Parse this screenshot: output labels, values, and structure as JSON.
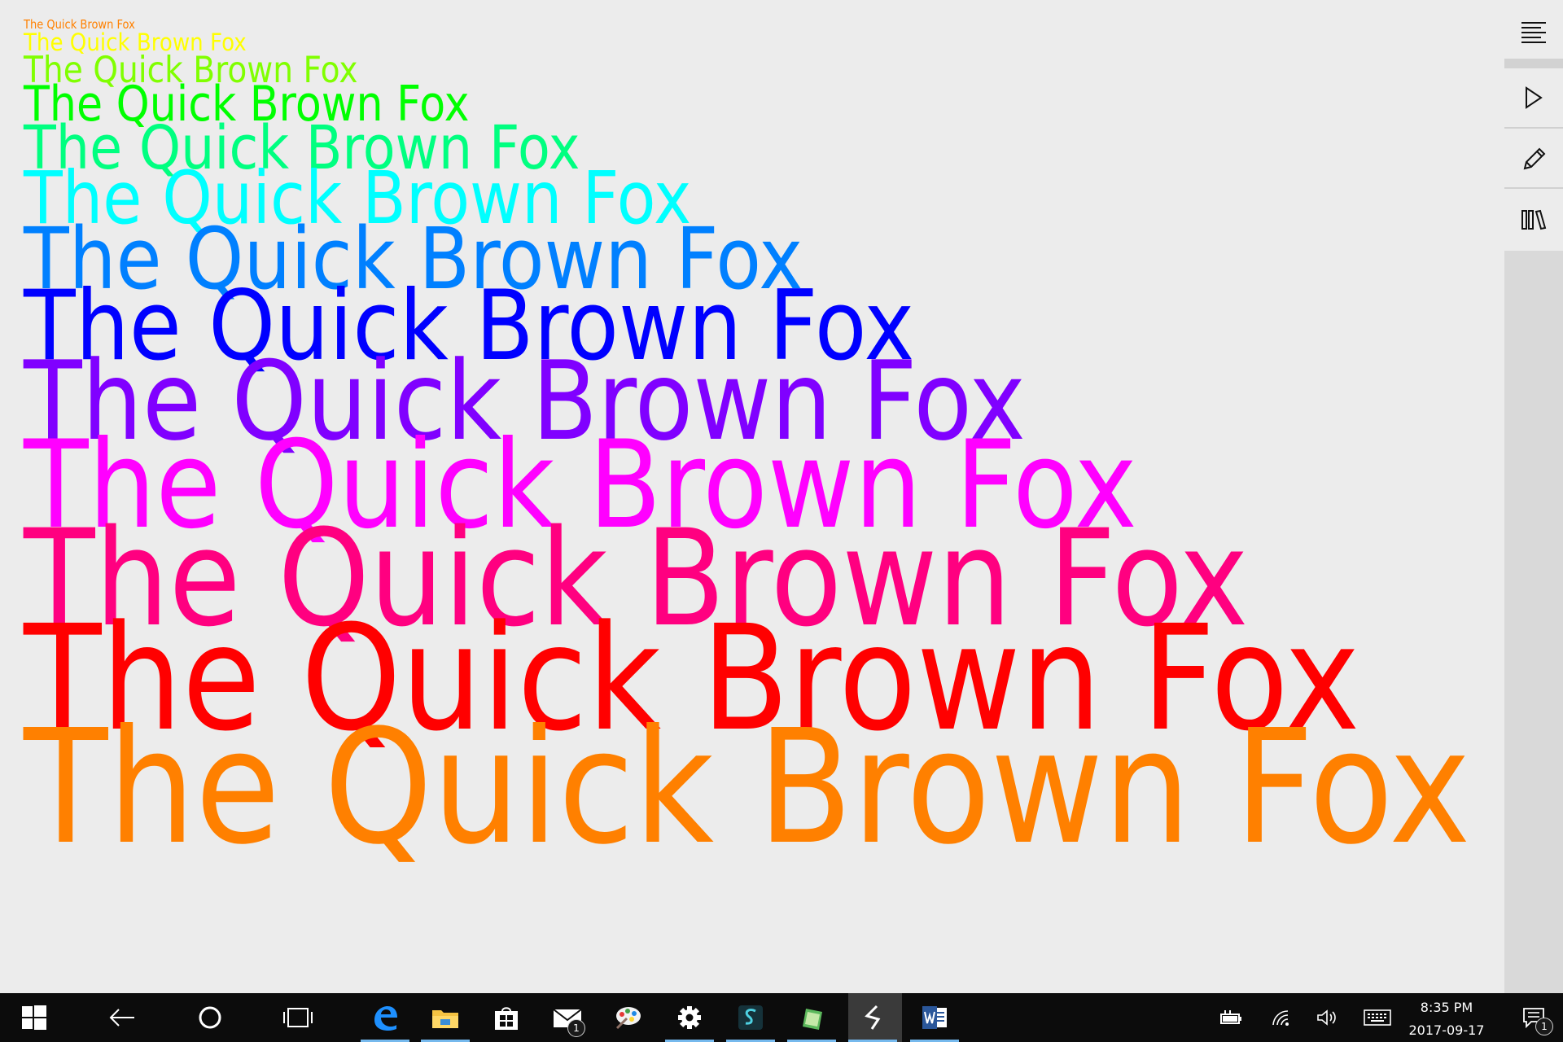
{
  "canvas": {
    "lines": [
      {
        "text": "The Quick Brown Fox",
        "color": "#ff8000",
        "size": 12
      },
      {
        "text": "The Quick Brown Fox",
        "color": "#ffff00",
        "size": 24
      },
      {
        "text": "The Quick Brown Fox",
        "color": "#80ff00",
        "size": 36
      },
      {
        "text": "The Quick Brown Fox",
        "color": "#00ff00",
        "size": 48
      },
      {
        "text": "The Quick Brown Fox",
        "color": "#00ff80",
        "size": 60
      },
      {
        "text": "The Quick Brown Fox",
        "color": "#00ffff",
        "size": 72
      },
      {
        "text": "The Quick Brown Fox",
        "color": "#0080ff",
        "size": 84
      },
      {
        "text": "The Quick Brown Fox",
        "color": "#0000ff",
        "size": 96
      },
      {
        "text": "The Quick Brown Fox",
        "color": "#8000ff",
        "size": 108
      },
      {
        "text": "The Quick Brown Fox",
        "color": "#ff00ff",
        "size": 120
      },
      {
        "text": "The Quick Brown Fox",
        "color": "#ff0080",
        "size": 132
      },
      {
        "text": "The Quick Brown Fox",
        "color": "#ff0000",
        "size": 144
      },
      {
        "text": "The Quick Brown Fox",
        "color": "#ff8000",
        "size": 156
      }
    ]
  },
  "sidebar": {
    "buttons": [
      {
        "name": "menu-lines-icon"
      },
      {
        "name": "play-icon"
      },
      {
        "name": "pencil-icon"
      },
      {
        "name": "library-icon"
      }
    ]
  },
  "taskbar": {
    "apps": [
      {
        "name": "edge-icon"
      },
      {
        "name": "file-explorer-icon"
      },
      {
        "name": "store-icon"
      },
      {
        "name": "mail-icon"
      },
      {
        "name": "paint-icon"
      },
      {
        "name": "settings-gear-icon"
      },
      {
        "name": "s-app-icon"
      },
      {
        "name": "green-app-icon"
      },
      {
        "name": "active-app-icon"
      },
      {
        "name": "word-icon"
      }
    ],
    "mail_badge": "1",
    "notification_badge": "1",
    "clock": {
      "time": "8:35 PM",
      "date": "2017-09-17"
    }
  }
}
